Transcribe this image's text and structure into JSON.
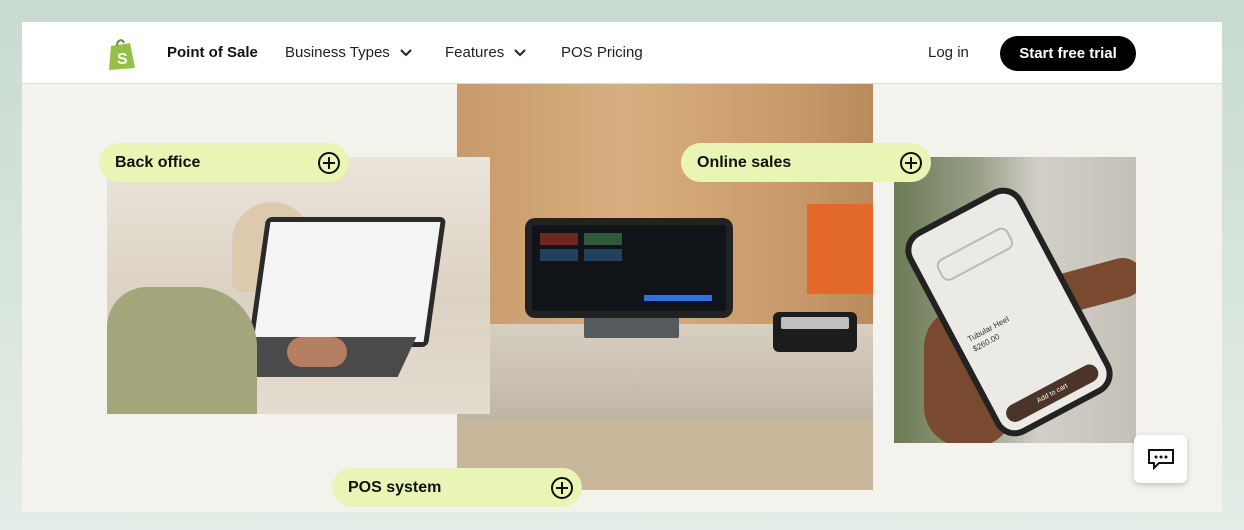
{
  "nav": {
    "logo": "shopify-bag",
    "brand": "Point of Sale",
    "items": [
      {
        "label": "Business Types",
        "dropdown": true
      },
      {
        "label": "Features",
        "dropdown": true
      },
      {
        "label": "POS Pricing",
        "dropdown": false
      }
    ],
    "login": "Log in",
    "cta": "Start free trial"
  },
  "features": [
    {
      "label": "Back office",
      "icon": "plus-circle-icon"
    },
    {
      "label": "Online sales",
      "icon": "plus-circle-icon"
    },
    {
      "label": "POS system",
      "icon": "plus-circle-icon"
    }
  ],
  "phone_screen": {
    "product": "Tubular Heel",
    "price": "$260.00",
    "button": "Add to cart"
  },
  "colors": {
    "pill": "#e8f5b5",
    "cta": "#000000",
    "logo": "#95bf47",
    "background": "#f3f2ec"
  }
}
